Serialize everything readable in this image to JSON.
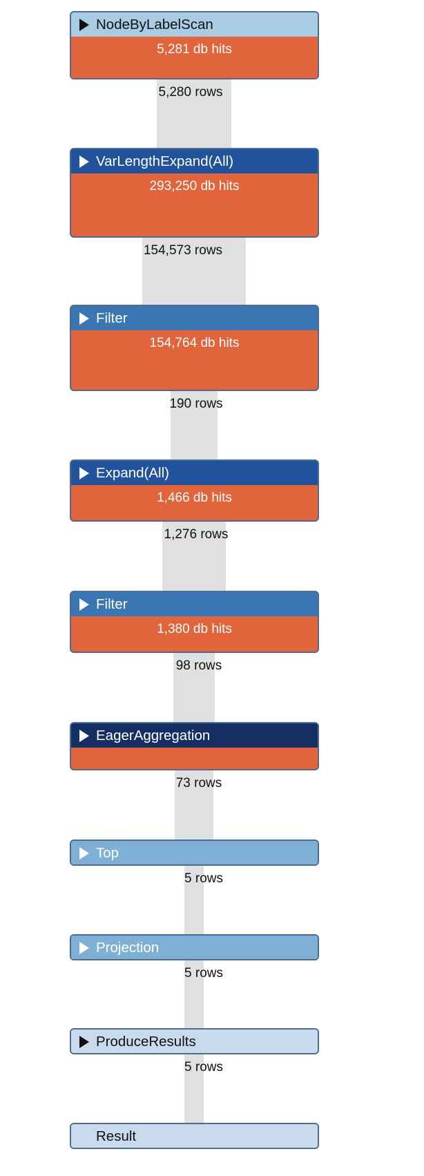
{
  "plan": {
    "operators": [
      {
        "name": "NodeByLabelScan",
        "db_hits": "5,281 db hits",
        "header_color": "#a9cce3",
        "text_color": "#111111",
        "expandable": true
      },
      {
        "name": "VarLengthExpand(All)",
        "db_hits": "293,250 db hits",
        "header_color": "#20539c",
        "text_color": "#ffffff",
        "expandable": true
      },
      {
        "name": "Filter",
        "db_hits": "154,764 db hits",
        "header_color": "#3a75b4",
        "text_color": "#ffffff",
        "expandable": true
      },
      {
        "name": "Expand(All)",
        "db_hits": "1,466 db hits",
        "header_color": "#20539c",
        "text_color": "#ffffff",
        "expandable": true
      },
      {
        "name": "Filter",
        "db_hits": "1,380 db hits",
        "header_color": "#3a75b4",
        "text_color": "#ffffff",
        "expandable": true
      },
      {
        "name": "EagerAggregation",
        "db_hits": "",
        "header_color": "#142f63",
        "text_color": "#ffffff",
        "expandable": true
      },
      {
        "name": "Top",
        "db_hits": null,
        "header_color": "#7eb0d6",
        "text_color": "#ffffff",
        "expandable": true
      },
      {
        "name": "Projection",
        "db_hits": null,
        "header_color": "#7eb0d6",
        "text_color": "#ffffff",
        "expandable": true
      },
      {
        "name": "ProduceResults",
        "db_hits": null,
        "header_color": "#c8dbed",
        "text_color": "#111111",
        "expandable": true
      },
      {
        "name": "Result",
        "db_hits": null,
        "header_color": "#c8dbed",
        "text_color": "#111111",
        "expandable": false
      }
    ],
    "rows": [
      {
        "label": "5,280 rows",
        "count": 5280
      },
      {
        "label": "154,573 rows",
        "count": 154573
      },
      {
        "label": "190 rows",
        "count": 190
      },
      {
        "label": "1,276 rows",
        "count": 1276
      },
      {
        "label": "98 rows",
        "count": 98
      },
      {
        "label": "73 rows",
        "count": 73
      },
      {
        "label": "5 rows",
        "count": 5
      },
      {
        "label": "5 rows",
        "count": 5
      },
      {
        "label": "5 rows",
        "count": 5
      }
    ],
    "colors": {
      "db_hits_bar": "#e1643a",
      "pipe": "#dfe0e2",
      "border": "#4d6b8d"
    }
  }
}
